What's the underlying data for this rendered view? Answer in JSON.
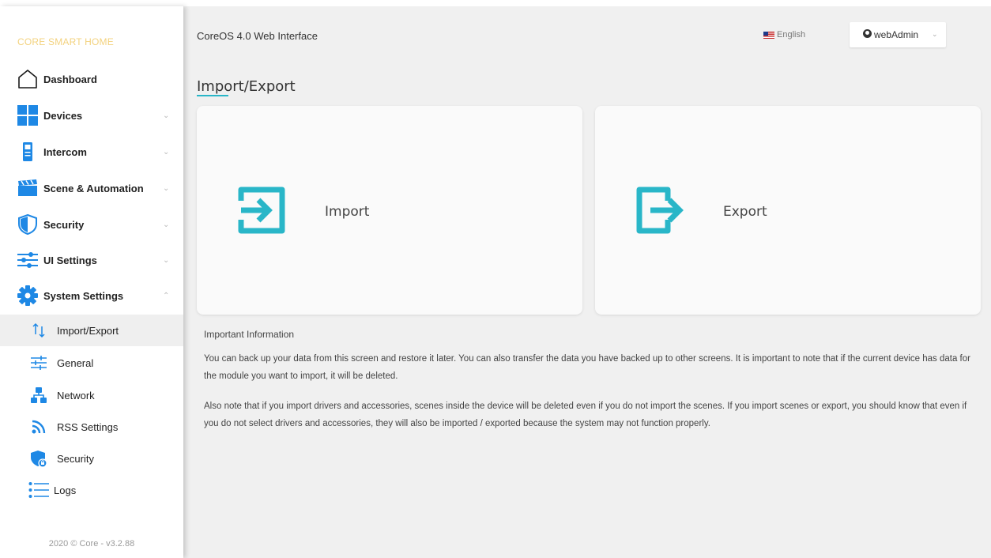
{
  "sidebar": {
    "brand": "CORE SMART HOME",
    "items": [
      {
        "label": "Dashboard",
        "icon": "home-icon",
        "chevron": ""
      },
      {
        "label": "Devices",
        "icon": "grid-icon",
        "chevron": "⌄"
      },
      {
        "label": "Intercom",
        "icon": "intercom-icon",
        "chevron": "⌄"
      },
      {
        "label": "Scene & Automation",
        "icon": "clapperboard-icon",
        "chevron": "⌄"
      },
      {
        "label": "Security",
        "icon": "shield-icon",
        "chevron": "⌄"
      },
      {
        "label": "UI Settings",
        "icon": "sliders-icon",
        "chevron": "⌄"
      },
      {
        "label": "System Settings",
        "icon": "gear-icon",
        "chevron": "⌃"
      }
    ],
    "subitems": [
      {
        "label": "Import/Export",
        "icon": "arrows-updown-icon",
        "active": true
      },
      {
        "label": "General",
        "icon": "settings-sliders-icon",
        "active": false
      },
      {
        "label": "Network",
        "icon": "network-icon",
        "active": false
      },
      {
        "label": "RSS Settings",
        "icon": "rss-icon",
        "active": false
      },
      {
        "label": "Security",
        "icon": "shield-lock-icon",
        "active": false
      },
      {
        "label": "Logs",
        "icon": "list-icon",
        "active": false
      }
    ],
    "footer": "2020 © Core - v3.2.88"
  },
  "header": {
    "title": "CoreOS 4.0 Web Interface",
    "language": "English",
    "user": "webAdmin"
  },
  "page": {
    "title": "Import/Export",
    "cards": [
      {
        "label": "Import",
        "icon": "import-icon"
      },
      {
        "label": "Export",
        "icon": "export-icon"
      }
    ],
    "info_heading": "Important Information",
    "info_paragraphs": [
      "You can back up your data from this screen and restore it later. You can also transfer the data you have backed up to other screens. It is important to note that if the current device has data for the module you want to import, it will be deleted.",
      "Also note that if you import drivers and accessories, scenes inside the device will be deleted even if you do not import the scenes. If you import scenes or export, you should know that even if you do not select drivers and accessories, they will also be imported / exported because the system may not function properly."
    ]
  },
  "colors": {
    "accent": "#29b6c8",
    "brand": "#f3d27e",
    "icon_blue": "#1e88e5"
  }
}
